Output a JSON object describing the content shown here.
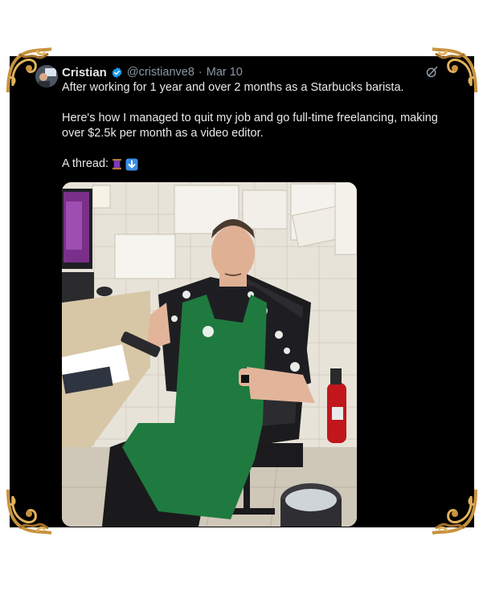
{
  "tweet": {
    "author_name": "Cristian",
    "handle": "@cristianve8",
    "separator": "·",
    "date": "Mar 10",
    "paragraph_1": "After working for 1 year and over 2 months as a Starbucks barista.",
    "paragraph_2": "Here's how I managed to quit my job and go full-time freelancing, making over $2.5k per month as a video editor.",
    "thread_label": "A thread:",
    "thread_emojis": [
      "spool-icon",
      "down-arrow-icon"
    ]
  },
  "icons": {
    "verified": "verified-badge-icon",
    "grok": "grok-icon"
  },
  "colors": {
    "card_background": "#000000",
    "page_background": "#ffffff",
    "text_primary": "#e7e9ea",
    "text_secondary": "#8b98a5",
    "verified_blue": "#1d9bf0",
    "apron_green": "#1f7a3f",
    "frame_gold": "#c8923f"
  }
}
